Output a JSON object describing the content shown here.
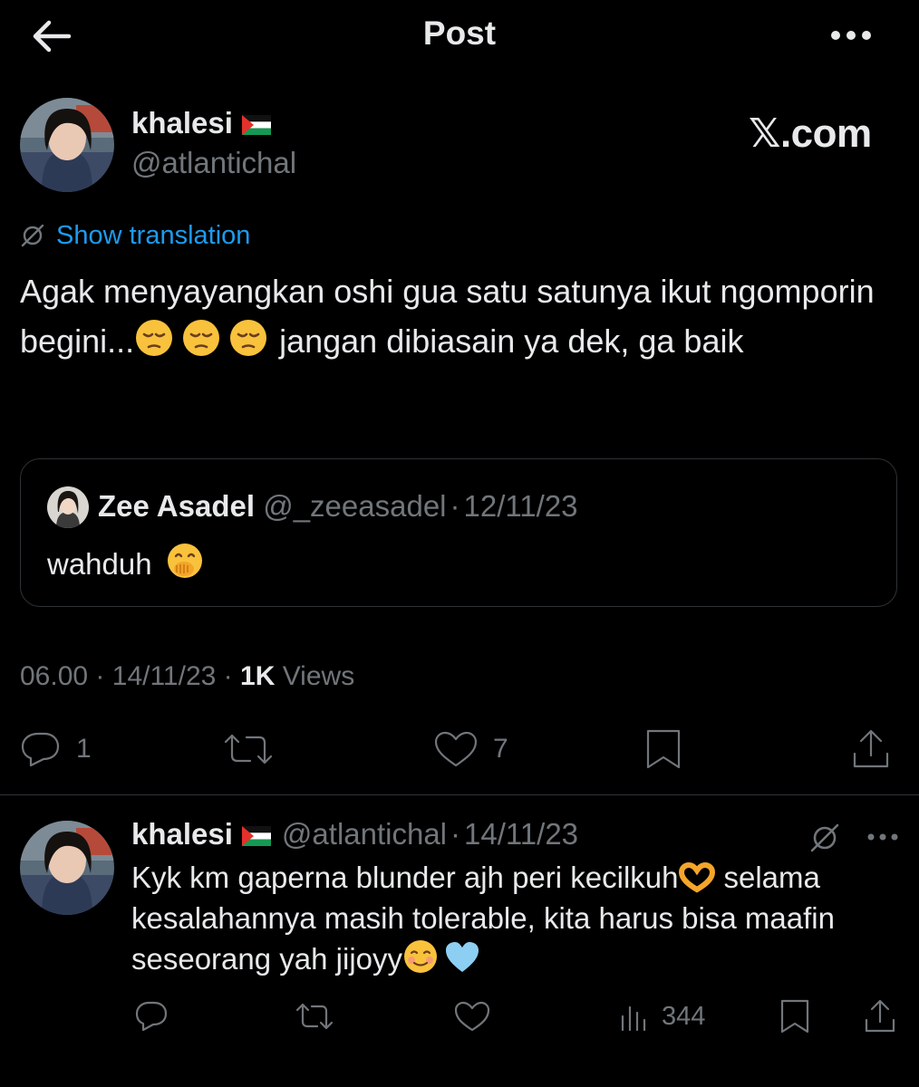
{
  "header": {
    "title": "Post",
    "back_icon": "arrow-left-icon",
    "more_icon": "more-horizontal-icon"
  },
  "author": {
    "name": "khalesi",
    "flag_icon": "palestine-flag-icon",
    "handle": "@atlantichal"
  },
  "watermark": "𝕏.com",
  "translation": {
    "label": "Show translation",
    "icon": "translate-off-icon"
  },
  "tweet": {
    "text_parts": [
      "Agak menyayangkan oshi gua satu satunya ikut ngomporin begini...",
      "jangan dibiasain ya dek, ga baik"
    ],
    "emojis": [
      "pensive-face-emoji",
      "pensive-face-emoji",
      "pensive-face-emoji"
    ]
  },
  "quote": {
    "name": "Zee Asadel",
    "handle": "@_zeeasadel",
    "separator": "·",
    "date": "12/11/23",
    "text": "wahduh",
    "emoji": "face-with-hand-over-mouth-emoji"
  },
  "meta": {
    "time": "06.00",
    "separator": "·",
    "date": "14/11/23",
    "views_count": "1K",
    "views_label": "Views"
  },
  "actions": {
    "reply_count": "1",
    "like_count": "7",
    "icons": [
      "reply-icon",
      "retweet-icon",
      "like-icon",
      "bookmark-icon",
      "share-icon"
    ]
  },
  "reply": {
    "name": "khalesi",
    "flag_icon": "palestine-flag-icon",
    "handle": "@atlantichal",
    "separator": "·",
    "date": "14/11/23",
    "text_parts": [
      "Kyk km gaperna blunder ajh peri kecilkuh",
      "selama kesalahannya masih tolerable, kita harus bisa maafin seseorang yah jijoyy"
    ],
    "emojis": [
      "heart-hands-emoji",
      "smiling-face-emoji",
      "light-blue-heart-emoji"
    ],
    "views_count": "344",
    "icons": [
      "reply-icon",
      "retweet-icon",
      "like-icon",
      "views-icon",
      "bookmark-icon",
      "share-icon"
    ]
  },
  "colors": {
    "background": "#000000",
    "text": "#e7e9ea",
    "muted": "#71767b",
    "link": "#1d9bf0",
    "border": "#2f3336"
  }
}
